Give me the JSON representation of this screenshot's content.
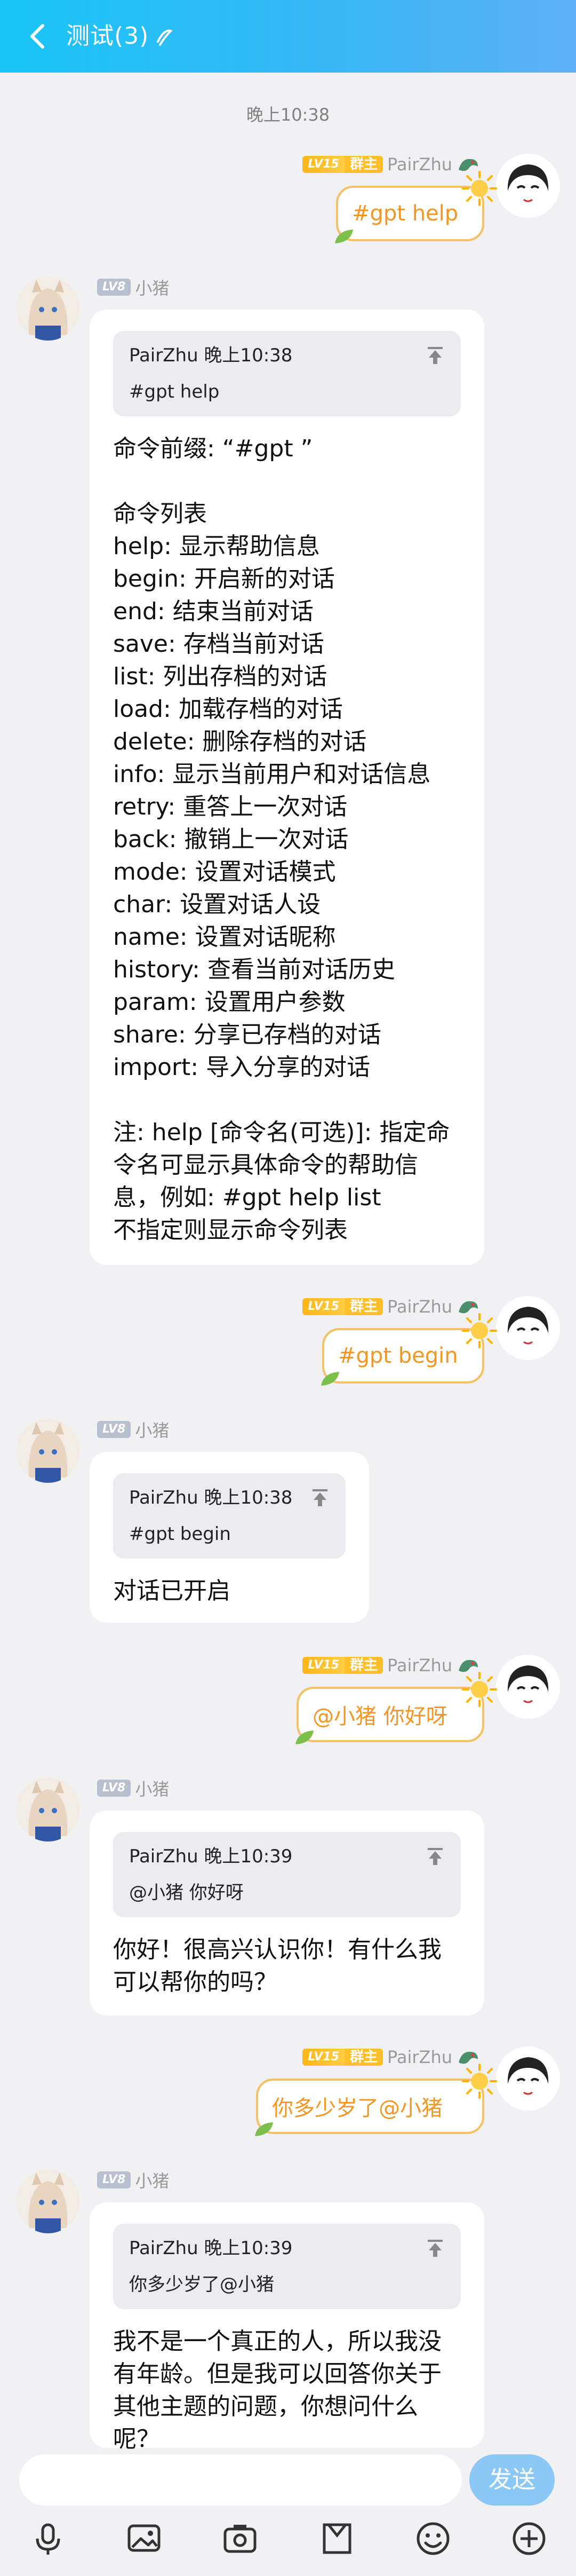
{
  "header": {
    "title": "测试(3)"
  },
  "timestamps": {
    "t1": "晚上10:38"
  },
  "user": {
    "name": "PairZhu",
    "level": "LV15",
    "role": "群主"
  },
  "bot": {
    "name": "小猪",
    "level": "LV8"
  },
  "messages": [
    {
      "id": "u1",
      "text": "#gpt help"
    },
    {
      "id": "b1",
      "quote_head": "PairZhu 晚上10:38",
      "quote_text": "#gpt help",
      "text": "命令前缀: “#gpt ”\n\n命令列表\nhelp: 显示帮助信息\nbegin: 开启新的对话\nend: 结束当前对话\nsave: 存档当前对话\nlist: 列出存档的对话\nload: 加载存档的对话\ndelete: 删除存档的对话\ninfo: 显示当前用户和对话信息\nretry: 重答上一次对话\nback: 撤销上一次对话\nmode: 设置对话模式\nchar: 设置对话人设\nname: 设置对话昵称\nhistory: 查看当前对话历史\nparam: 设置用户参数\nshare: 分享已存档的对话\nimport: 导入分享的对话\n\n注: help [命令名(可选)]: 指定命令名可显示具体命令的帮助信息，例如: #gpt help list\n不指定则显示命令列表"
    },
    {
      "id": "u2",
      "text": "#gpt begin"
    },
    {
      "id": "b2",
      "quote_head": "PairZhu 晚上10:38",
      "quote_text": "#gpt begin",
      "text": "对话已开启"
    },
    {
      "id": "u3",
      "text": "@小猪  你好呀"
    },
    {
      "id": "b3",
      "quote_head": "PairZhu 晚上10:39",
      "quote_text": "@小猪  你好呀",
      "text": "你好！很高兴认识你！有什么我可以帮你的吗？"
    },
    {
      "id": "u4",
      "text": "你多少岁了@小猪"
    },
    {
      "id": "b4",
      "quote_head": "PairZhu 晚上10:39",
      "quote_text": "你多少岁了@小猪",
      "text": "我不是一个真正的人，所以我没有年龄。但是我可以回答你关于其他主题的问题，你想问什么呢？"
    }
  ],
  "input": {
    "send_label": "发送"
  },
  "toolbar": [
    "mic-icon",
    "image-icon",
    "camera-icon",
    "file-icon",
    "emoji-icon",
    "plus-icon"
  ],
  "colors": {
    "header": "#26bdf5",
    "user_bubble_border": "#f6c065",
    "user_text": "#f39622",
    "send": "#8bc8f5"
  }
}
